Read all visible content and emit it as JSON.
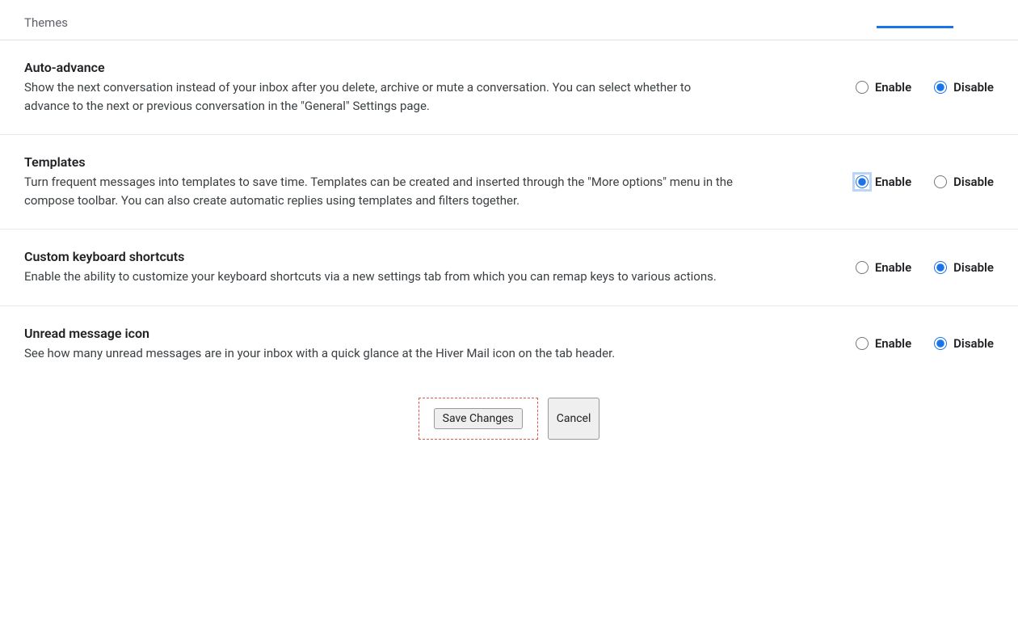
{
  "nav": {
    "themes_label": "Themes"
  },
  "labels": {
    "enable": "Enable",
    "disable": "Disable"
  },
  "settings": [
    {
      "id": "auto-advance",
      "title": "Auto-advance",
      "description": "Show the next conversation instead of your inbox after you delete, archive or mute a conversation. You can select whether to advance to the next or previous conversation in the \"General\" Settings page.",
      "selected": "disable",
      "highlighted": false
    },
    {
      "id": "templates",
      "title": "Templates",
      "description": "Turn frequent messages into templates to save time. Templates can be created and inserted through the \"More options\" menu in the compose toolbar. You can also create automatic replies using templates and filters together.",
      "selected": "enable",
      "highlighted": true
    },
    {
      "id": "custom-keyboard-shortcuts",
      "title": "Custom keyboard shortcuts",
      "description": "Enable the ability to customize your keyboard shortcuts via a new settings tab from which you can remap keys to various actions.",
      "selected": "disable",
      "highlighted": false
    },
    {
      "id": "unread-message-icon",
      "title": "Unread message icon",
      "description": "See how many unread messages are in your inbox with a quick glance at the Hiver Mail icon on the tab header.",
      "selected": "disable",
      "highlighted": false
    }
  ],
  "actions": {
    "save_label": "Save Changes",
    "cancel_label": "Cancel"
  }
}
